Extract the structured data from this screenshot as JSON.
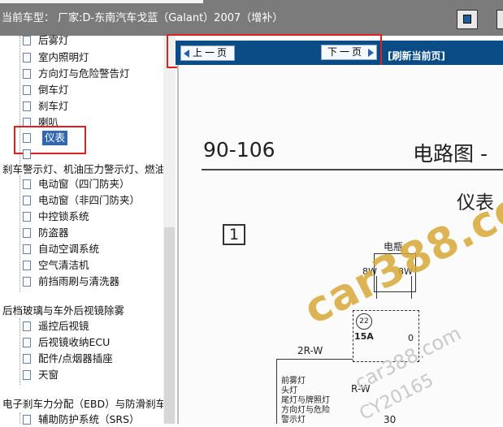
{
  "header": {
    "title": "当前车型：  厂家:D-东南汽车戈蓝（Galant）2007（增补）"
  },
  "tree": {
    "items": [
      {
        "label": "后雾灯",
        "type": "leaf"
      },
      {
        "label": "室内照明灯",
        "type": "leaf"
      },
      {
        "label": "方向灯与危险警告灯",
        "type": "leaf"
      },
      {
        "label": "倒车灯",
        "type": "leaf"
      },
      {
        "label": "刹车灯",
        "type": "leaf"
      },
      {
        "label": "喇叭",
        "type": "leaf"
      },
      {
        "label": "仪表",
        "type": "leaf",
        "selected": true
      },
      {
        "label": "",
        "type": "leaf"
      },
      {
        "label": "刹车警示灯、机油压力警示灯、燃油",
        "type": "folder"
      },
      {
        "label": "电动窗（四门防夹）",
        "type": "leaf"
      },
      {
        "label": "电动窗（非四门防夹）",
        "type": "leaf"
      },
      {
        "label": "中控锁系统",
        "type": "leaf"
      },
      {
        "label": "防盗器",
        "type": "leaf"
      },
      {
        "label": "自动空调系统",
        "type": "leaf"
      },
      {
        "label": "空气清洁机",
        "type": "leaf"
      },
      {
        "label": "前挡雨刷与清洗器",
        "type": "leaf"
      },
      {
        "label": "后档玻璃与车外后视镜除雾",
        "type": "folder"
      },
      {
        "label": "遥控后视镜",
        "type": "leaf"
      },
      {
        "label": "后视镜收纳ECU",
        "type": "leaf"
      },
      {
        "label": "配件/点烟器插座",
        "type": "leaf"
      },
      {
        "label": "天窗",
        "type": "leaf"
      },
      {
        "label": "电子刹车力分配（EBD）与防滑刹车",
        "type": "folder"
      },
      {
        "label": "辅助防护系统（SRS）",
        "type": "leaf"
      }
    ]
  },
  "nav": {
    "prev_label": "上一页",
    "next_label": "下一页",
    "refresh_label": "[刷新当前页]"
  },
  "document": {
    "page_number": "90-106",
    "heading": "电路图 -",
    "subheading": "仪表",
    "section_number": "1",
    "battery_label": "电瓶",
    "wire1": "8W",
    "wire2": "8W",
    "fuse_number": "22",
    "fuse_rating": "15A",
    "fuse_side": "0",
    "wire3": "2R-W",
    "wire4": "R-W",
    "wire5": "30",
    "notes": [
      "前雾灯",
      "头灯",
      "尾灯与牌照灯",
      "方向灯与危险",
      "警示灯"
    ]
  },
  "watermark": {
    "main": "car388.com",
    "sub1": "car388.com",
    "sub2": "CY20165"
  }
}
